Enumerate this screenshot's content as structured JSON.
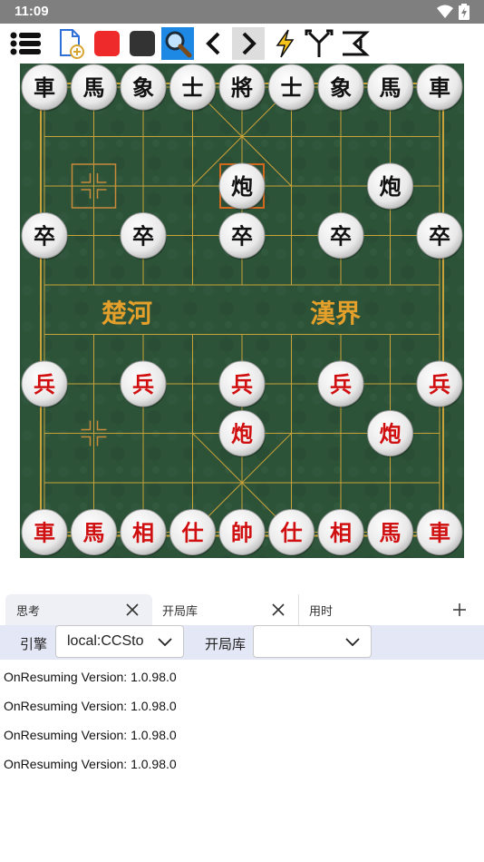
{
  "status_bar": {
    "time": "11:09",
    "icons": [
      "wifi-icon",
      "battery-icon"
    ]
  },
  "toolbar": {
    "buttons": [
      "menu-icon",
      "new-game-icon",
      "red-square-icon",
      "black-square-icon",
      "search-icon",
      "back-icon",
      "forward-icon",
      "lightning-icon",
      "branch-icon",
      "flip-icon"
    ]
  },
  "board": {
    "river_left": "楚河",
    "river_right": "漢界",
    "pieces": [
      {
        "t": "車",
        "c": "black",
        "col": 0,
        "row": 0
      },
      {
        "t": "馬",
        "c": "black",
        "col": 1,
        "row": 0
      },
      {
        "t": "象",
        "c": "black",
        "col": 2,
        "row": 0
      },
      {
        "t": "士",
        "c": "black",
        "col": 3,
        "row": 0
      },
      {
        "t": "將",
        "c": "black",
        "col": 4,
        "row": 0
      },
      {
        "t": "士",
        "c": "black",
        "col": 5,
        "row": 0
      },
      {
        "t": "象",
        "c": "black",
        "col": 6,
        "row": 0
      },
      {
        "t": "馬",
        "c": "black",
        "col": 7,
        "row": 0
      },
      {
        "t": "車",
        "c": "black",
        "col": 8,
        "row": 0
      },
      {
        "t": "炮",
        "c": "black",
        "col": 4,
        "row": 2
      },
      {
        "t": "炮",
        "c": "black",
        "col": 7,
        "row": 2
      },
      {
        "t": "卒",
        "c": "black",
        "col": 0,
        "row": 3
      },
      {
        "t": "卒",
        "c": "black",
        "col": 2,
        "row": 3
      },
      {
        "t": "卒",
        "c": "black",
        "col": 4,
        "row": 3
      },
      {
        "t": "卒",
        "c": "black",
        "col": 6,
        "row": 3
      },
      {
        "t": "卒",
        "c": "black",
        "col": 8,
        "row": 3
      },
      {
        "t": "兵",
        "c": "red",
        "col": 0,
        "row": 6
      },
      {
        "t": "兵",
        "c": "red",
        "col": 2,
        "row": 6
      },
      {
        "t": "兵",
        "c": "red",
        "col": 4,
        "row": 6
      },
      {
        "t": "兵",
        "c": "red",
        "col": 6,
        "row": 6
      },
      {
        "t": "兵",
        "c": "red",
        "col": 8,
        "row": 6
      },
      {
        "t": "炮",
        "c": "red",
        "col": 4,
        "row": 7
      },
      {
        "t": "炮",
        "c": "red",
        "col": 7,
        "row": 7
      },
      {
        "t": "車",
        "c": "red",
        "col": 0,
        "row": 9
      },
      {
        "t": "馬",
        "c": "red",
        "col": 1,
        "row": 9
      },
      {
        "t": "相",
        "c": "red",
        "col": 2,
        "row": 9
      },
      {
        "t": "仕",
        "c": "red",
        "col": 3,
        "row": 9
      },
      {
        "t": "帥",
        "c": "red",
        "col": 4,
        "row": 9
      },
      {
        "t": "仕",
        "c": "red",
        "col": 5,
        "row": 9
      },
      {
        "t": "相",
        "c": "red",
        "col": 6,
        "row": 9
      },
      {
        "t": "馬",
        "c": "red",
        "col": 7,
        "row": 9
      },
      {
        "t": "車",
        "c": "red",
        "col": 8,
        "row": 9
      }
    ],
    "last_move_from": {
      "col": 1,
      "row": 2
    },
    "last_move_to": {
      "col": 4,
      "row": 2
    },
    "hint_mark": {
      "col": 1,
      "row": 7
    }
  },
  "tabs": [
    {
      "label": "思考",
      "active": true,
      "closable": true
    },
    {
      "label": "开局库",
      "active": false,
      "closable": true
    },
    {
      "label": "用时",
      "active": false,
      "closable": false
    }
  ],
  "engine_bar": {
    "engine_label": "引擎",
    "engine_value": "local:CCSto",
    "book_label": "开局库",
    "book_value": ""
  },
  "log": [
    "OnResuming Version: 1.0.98.0",
    "OnResuming Version: 1.0.98.0",
    "OnResuming Version: 1.0.98.0",
    "OnResuming Version: 1.0.98.0"
  ],
  "colors": {
    "board": "#2c5238",
    "red_piece": "#d01010",
    "black_piece": "#111111",
    "highlight": "#d2691e",
    "accent": "#1e88e5"
  }
}
